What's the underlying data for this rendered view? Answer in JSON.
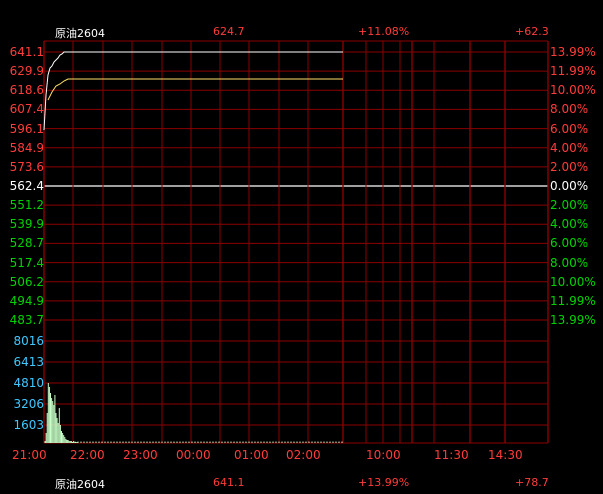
{
  "header": {
    "name": "原油2604",
    "price": "624.7",
    "pct": "+11.08%",
    "change": "+62.3"
  },
  "footer": {
    "name": "原油2604",
    "price": "641.1",
    "pct": "+13.99%",
    "change": "+78.7"
  },
  "price_axis": {
    "labels": [
      "641.1",
      "629.9",
      "618.6",
      "607.4",
      "596.1",
      "584.9",
      "573.6",
      "562.4",
      "551.2",
      "539.9",
      "528.7",
      "517.4",
      "506.2",
      "494.9",
      "483.7"
    ],
    "pct_labels": [
      "13.99%",
      "11.99%",
      "10.00%",
      "8.00%",
      "6.00%",
      "4.00%",
      "2.00%",
      "0.00%",
      "2.00%",
      "4.00%",
      "6.00%",
      "8.00%",
      "10.00%",
      "11.99%",
      "13.99%"
    ],
    "base_index": 7
  },
  "volume_axis": {
    "labels": [
      "8016",
      "6413",
      "4810",
      "3206",
      "1603"
    ]
  },
  "time_axis": {
    "labels": [
      "21:00",
      "22:00",
      "23:00",
      "00:00",
      "01:00",
      "02:00",
      "10:00",
      "11:30",
      "14:30"
    ]
  },
  "colors": {
    "grid": "#8b0000",
    "up": "#ff3b3b",
    "down": "#00d400",
    "flat": "#ffffff",
    "volume_label": "#40c8ff",
    "volume_bar": "#c8ffc8",
    "price_line": "#ffffff",
    "avg_line": "#ffe066"
  }
}
